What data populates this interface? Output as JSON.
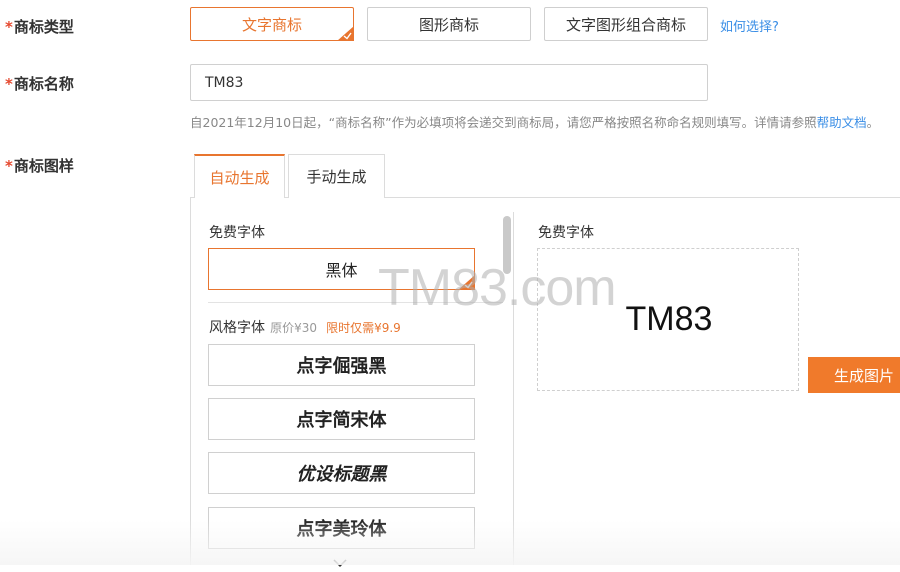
{
  "labels": {
    "required_mark": "*",
    "trademark_type": "商标类型",
    "trademark_name": "商标名称",
    "trademark_image": "商标图样"
  },
  "type_options": [
    {
      "label": "文字商标",
      "selected": true
    },
    {
      "label": "图形商标",
      "selected": false
    },
    {
      "label": "文字图形组合商标",
      "selected": false
    }
  ],
  "how_to_choose": "如何选择?",
  "name_input": {
    "value": "TM83"
  },
  "hint": {
    "text": "自2021年12月10日起，“商标名称”作为必填项将会递交到商标局，请您严格按照名称命名规则填写。详情请参照",
    "link": "帮助文档",
    "end": "。"
  },
  "tabs": [
    {
      "label": "自动生成",
      "active": true
    },
    {
      "label": "手动生成",
      "active": false
    }
  ],
  "left_panel": {
    "free_font_title": "免费字体",
    "selected_font": "黑体",
    "style_font_title": "风格字体",
    "original_price": "原价¥30",
    "sale_price": "限时仅需¥9.9",
    "style_fonts": [
      "点字倔强黑",
      "点字简宋体",
      "优设标题黑",
      "点字美玲体"
    ]
  },
  "right_panel": {
    "title": "免费字体",
    "preview_text": "TM83",
    "generate_button": "生成图片"
  },
  "watermark": "TM83.com",
  "colors": {
    "accent": "#e8752f",
    "button": "#f07a2b",
    "link": "#3a8ee6",
    "required": "#e5482e"
  },
  "icons": [
    "check-corner-icon",
    "chevron-down-icon"
  ]
}
